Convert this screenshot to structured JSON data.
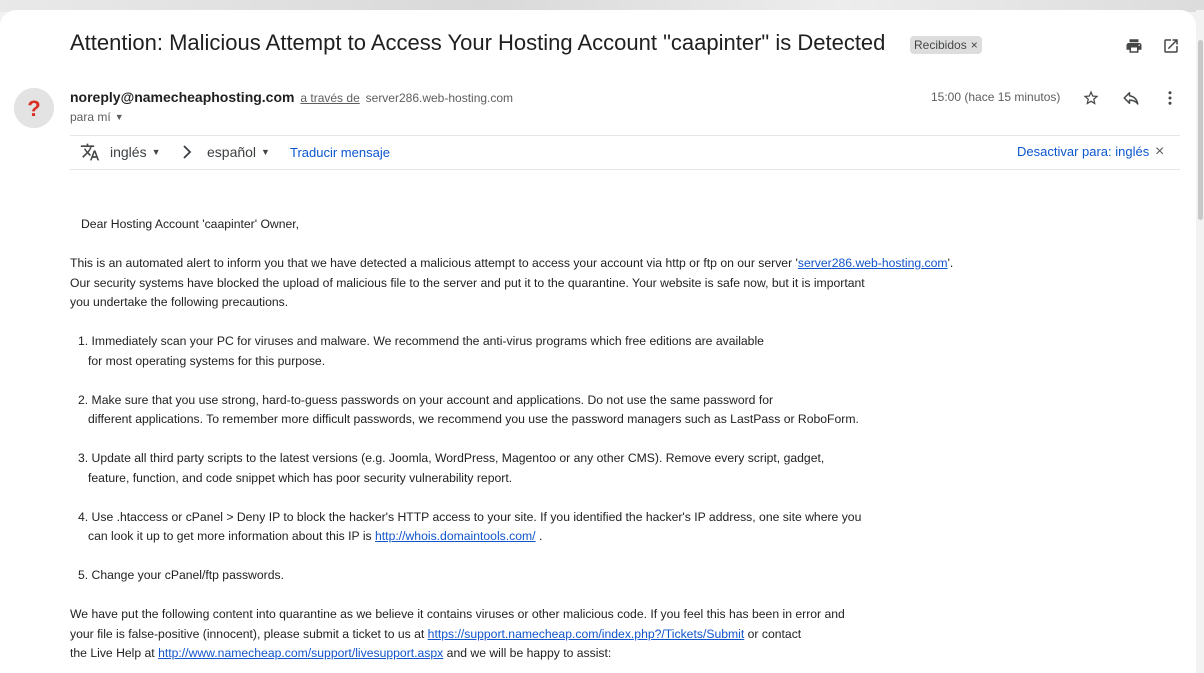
{
  "email": {
    "subject": "Attention: Malicious Attempt to Access Your Hosting Account \"caapinter\" is Detected",
    "label": "Recibidos",
    "label_remove": "×",
    "sender_email": "noreply@namecheaphosting.com",
    "via_label": "a través de",
    "via_server": "server286.web-hosting.com",
    "recipient": "para mí",
    "timestamp": "15:00 (hace 15 minutos)"
  },
  "translate": {
    "source_lang": "inglés",
    "target_lang": "español",
    "translate_link": "Traducir mensaje",
    "disable_link": "Desactivar para: inglés",
    "close": "×"
  },
  "body": {
    "greeting": "Dear Hosting Account 'caapinter' Owner,",
    "p1_a": "This is an automated alert to inform you that we have detected a malicious attempt to access your account via http or ftp on our server '",
    "p1_link": "server286.web-hosting.com",
    "p1_b": "'.",
    "p1_line2": "Our security systems have blocked the upload of malicious file to the server and put it to the quarantine. Your website is safe now, but it is important",
    "p1_line3": "you undertake the following precautions.",
    "item1_line1": "1. Immediately scan your PC for viruses and malware. We recommend the anti-virus programs which free editions are available",
    "item1_line2": "for most operating systems for this purpose.",
    "item2_line1": "2. Make sure that you use strong, hard-to-guess passwords on your account and applications. Do not use the same password for",
    "item2_line2": "different applications. To remember more difficult passwords, we recommend you use the password managers such as LastPass or RoboForm.",
    "item3_line1": "3. Update all third party scripts to the latest versions (e.g. Joomla, WordPress, Magentoo or any other CMS). Remove every script, gadget,",
    "item3_line2": "feature, function, and code snippet which has poor security vulnerability report.",
    "item4_line1": "4. Use .htaccess or cPanel > Deny IP to block the hacker's HTTP access to your site. If you identified the hacker's IP address, one site where you",
    "item4_line2_a": "can look it up to get more information about this IP is ",
    "item4_link": "http://whois.domaintools.com/",
    "item4_line2_b": " .",
    "item5": "5. Change your cPanel/ftp passwords.",
    "p2_line1": "We have put the following content into quarantine as we believe it contains viruses or other malicious code. If you feel this has been in error and",
    "p2_line2_a": "your file is false-positive (innocent), please submit a ticket to us at ",
    "p2_link1": "https://support.namecheap.com/index.php?/Tickets/Submit",
    "p2_line2_b": " or contact",
    "p2_line3_a": "the Live Help at ",
    "p2_link2": "http://www.namecheap.com/support/livesupport.aspx",
    "p2_line3_b": " and we will be happy to assist:"
  },
  "icons": {
    "print": "print-icon",
    "open_new_window": "open-in-new-window-icon",
    "star": "star-icon",
    "reply": "reply-icon",
    "more": "more-vert-icon",
    "translate": "translate-icon",
    "avatar": "unknown-sender-icon"
  },
  "colors": {
    "link": "#1155cc",
    "ui_link": "#0b57d0",
    "avatar_mark": "#d93025"
  }
}
